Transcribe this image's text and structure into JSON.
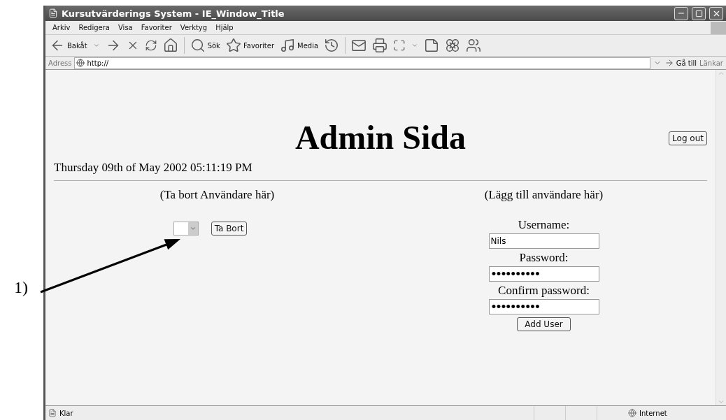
{
  "window": {
    "title": "Kursutvärderings System - IE_Window_Title"
  },
  "menu": [
    "Arkiv",
    "Redigera",
    "Visa",
    "Favoriter",
    "Verktyg",
    "Hjälp"
  ],
  "toolbar": {
    "back_label": "Bakåt",
    "search_label": "Sök",
    "favorites_label": "Favoriter",
    "media_label": "Media"
  },
  "address": {
    "label": "Adress",
    "value": "http://",
    "go_label": "Gå till",
    "links_label": "Länkar"
  },
  "page": {
    "heading": "Admin Sida",
    "logout": "Log out",
    "date": "Thursday 09th of May 2002 05:11:19 PM",
    "remove": {
      "heading": "(Ta bort Användare här)",
      "button": "Ta Bort"
    },
    "add": {
      "heading": "(Lägg till användare här)",
      "fields": [
        {
          "kind": "text",
          "label": "Username:",
          "value": "Nils"
        },
        {
          "kind": "password",
          "label": "Password:",
          "value": "••••••••••"
        },
        {
          "kind": "password",
          "label": "Confirm password:",
          "value": "••••••••••"
        }
      ],
      "button": "Add User"
    }
  },
  "status_bar": {
    "text": "Klar",
    "zone": "Internet"
  },
  "annotation": {
    "label": "1)"
  }
}
